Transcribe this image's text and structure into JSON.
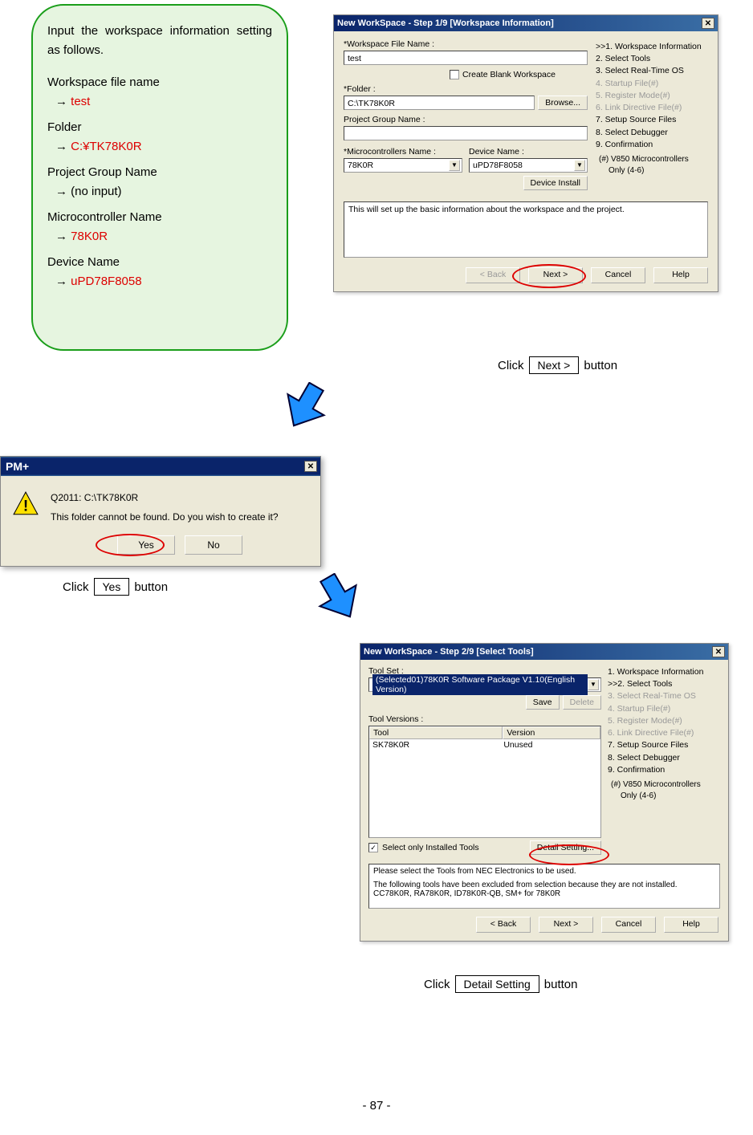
{
  "greenbox": {
    "intro": "Input the workspace information setting as follows.",
    "f1_label": "Workspace file name",
    "f1_value": "test",
    "f2_label": "Folder",
    "f2_value": "C:¥TK78K0R",
    "f3_label": "Project Group Name",
    "f3_value": "(no input)",
    "f4_label": "Microcontroller Name",
    "f4_value": "78K0R",
    "f5_label": "Device Name",
    "f5_value": "uPD78F8058"
  },
  "dlg1": {
    "title": "New WorkSpace - Step 1/9 [Workspace Information]",
    "lbl_ws": "*Workspace File Name :",
    "val_ws": "test",
    "chk_blank": "Create Blank Workspace",
    "lbl_folder": "*Folder :",
    "val_folder": "C:\\TK78K0R",
    "btn_browse": "Browse...",
    "lbl_pgroup": "Project Group Name :",
    "val_pgroup": "",
    "lbl_mcu": "*Microcontrollers Name :",
    "val_mcu": "78K0R",
    "lbl_dev": "Device Name :",
    "val_dev": "uPD78F8058",
    "btn_devinst": "Device Install",
    "desc": "This will set up the basic information about the workspace and the project.",
    "btn_back": "< Back",
    "btn_next": "Next >",
    "btn_cancel": "Cancel",
    "btn_help": "Help"
  },
  "steps": {
    "s1": ">>1. Workspace Information",
    "s2": "2. Select Tools",
    "s3": "3. Select Real-Time OS",
    "s4": "4. Startup File(#)",
    "s5": "5. Register Mode(#)",
    "s6": "6. Link Directive File(#)",
    "s7": "7. Setup Source Files",
    "s8": "8. Select Debugger",
    "s9": "9. Confirmation",
    "note1": "(#) V850 Microcontrollers",
    "note2": "Only (4-6)"
  },
  "steps2": {
    "s1": "1. Workspace Information",
    "s2": ">>2. Select Tools",
    "s3": "3. Select Real-Time OS",
    "s4": "4. Startup File(#)",
    "s5": "5. Register Mode(#)",
    "s6": "6. Link Directive File(#)",
    "s7": "7. Setup Source Files",
    "s8": "8. Select Debugger",
    "s9": "9. Confirmation",
    "note1": "(#) V850 Microcontrollers",
    "note2": "Only (4-6)"
  },
  "caption1": {
    "pre": "Click",
    "btn": "Next >",
    "post": "button"
  },
  "dlg2": {
    "title": "PM+",
    "line1": "Q2011: C:\\TK78K0R",
    "line2": "This folder cannot be found. Do you wish to create it?",
    "btn_yes": "Yes",
    "btn_no": "No"
  },
  "caption2": {
    "pre": "Click",
    "btn": "Yes",
    "post": "button"
  },
  "dlg3": {
    "title": "New WorkSpace - Step 2/9 [Select Tools]",
    "lbl_toolset": "Tool Set :",
    "val_toolset": "(Selected01)78K0R Software Package V1.10(English Version)",
    "btn_save": "Save",
    "btn_delete": "Delete",
    "lbl_toolver": "Tool Versions :",
    "th_tool": "Tool",
    "th_ver": "Version",
    "row1_tool": "SK78K0R",
    "row1_ver": "Unused",
    "chk_installed": "Select only Installed Tools",
    "btn_detail": "Detail Setting...",
    "desc1": "Please select the Tools from NEC Electronics to be used.",
    "desc2": "The following tools have been excluded from selection because they are not installed. CC78K0R, RA78K0R, ID78K0R-QB, SM+ for 78K0R",
    "btn_back": "< Back",
    "btn_next": "Next >",
    "btn_cancel": "Cancel",
    "btn_help": "Help"
  },
  "caption3": {
    "pre": "Click",
    "btn": "Detail Setting",
    "post": "button"
  },
  "page_num": "- 87 -"
}
